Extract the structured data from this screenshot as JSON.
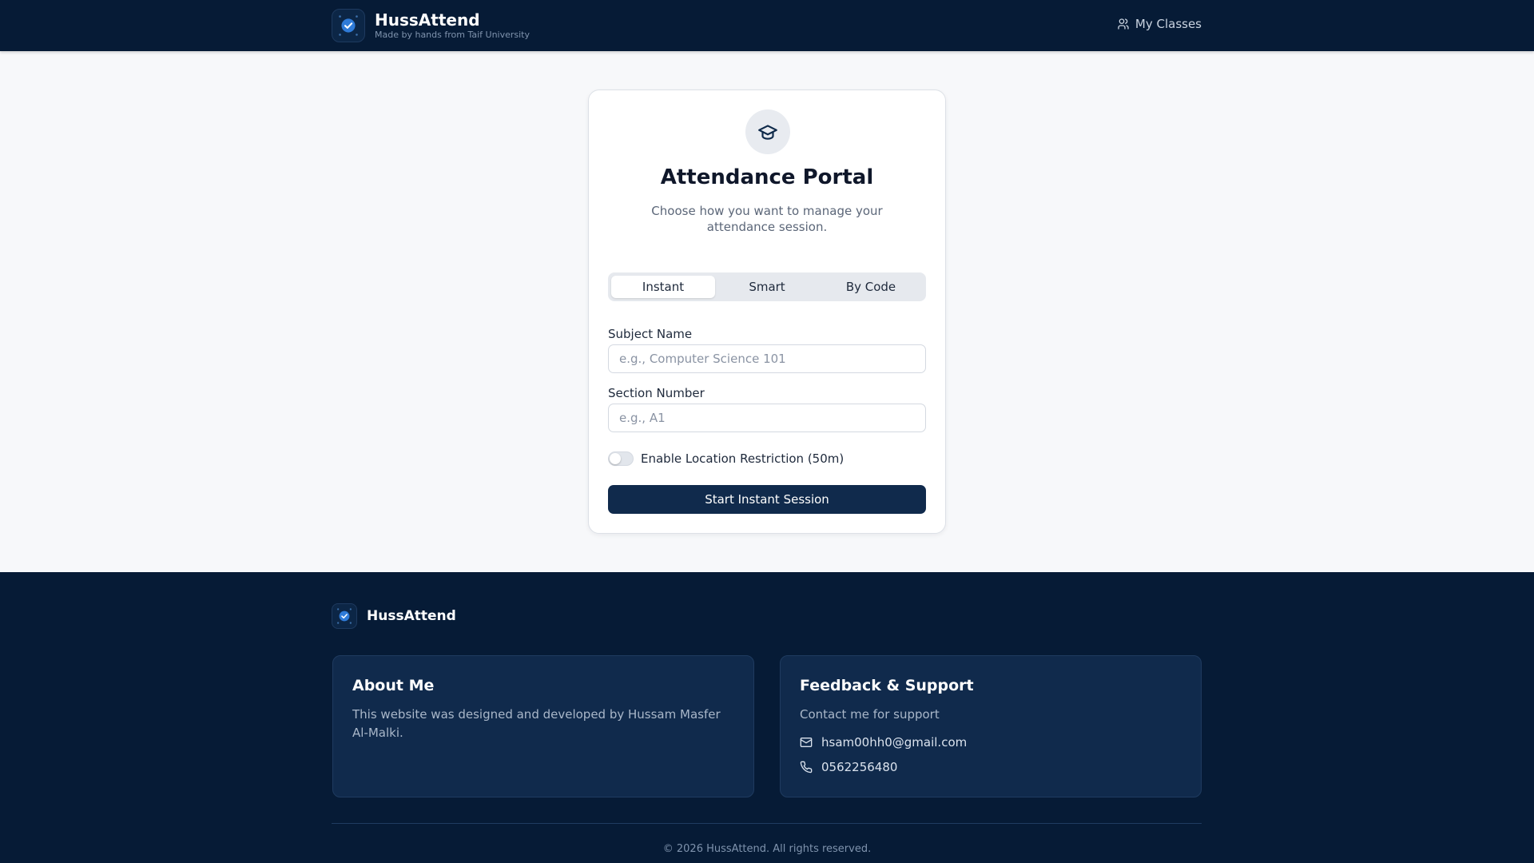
{
  "header": {
    "brand_name": "HussAttend",
    "brand_tagline": "Made by hands from Taif University",
    "nav_my_classes": "My Classes"
  },
  "portal": {
    "title": "Attendance Portal",
    "description": "Choose how you want to manage your attendance session.",
    "tabs": [
      {
        "label": "Instant",
        "active": true
      },
      {
        "label": "Smart",
        "active": false
      },
      {
        "label": "By Code",
        "active": false
      }
    ],
    "subject": {
      "label": "Subject Name",
      "value": "",
      "placeholder": "e.g., Computer Science 101"
    },
    "section": {
      "label": "Section Number",
      "value": "",
      "placeholder": "e.g., A1"
    },
    "location_toggle": {
      "label": "Enable Location Restriction (50m)",
      "on": false
    },
    "submit_label": "Start Instant Session"
  },
  "footer": {
    "brand_name": "HussAttend",
    "about": {
      "title": "About Me",
      "text": "This website was designed and developed by Hussam Masfer Al-Malki."
    },
    "support": {
      "title": "Feedback & Support",
      "subtitle": "Contact me for support",
      "email": "hsam00hh0@gmail.com",
      "phone": "0562256480"
    },
    "copyright": "© 2026 HussAttend. All rights reserved."
  },
  "icons": {
    "logo": "check-badge-icon",
    "nav": "users-icon",
    "portal": "graduation-cap-icon",
    "email": "mail-icon",
    "phone": "phone-icon"
  },
  "colors": {
    "navy": "#061b36",
    "primary_button": "#102a4c",
    "accent_blue": "#2f7bd8"
  }
}
